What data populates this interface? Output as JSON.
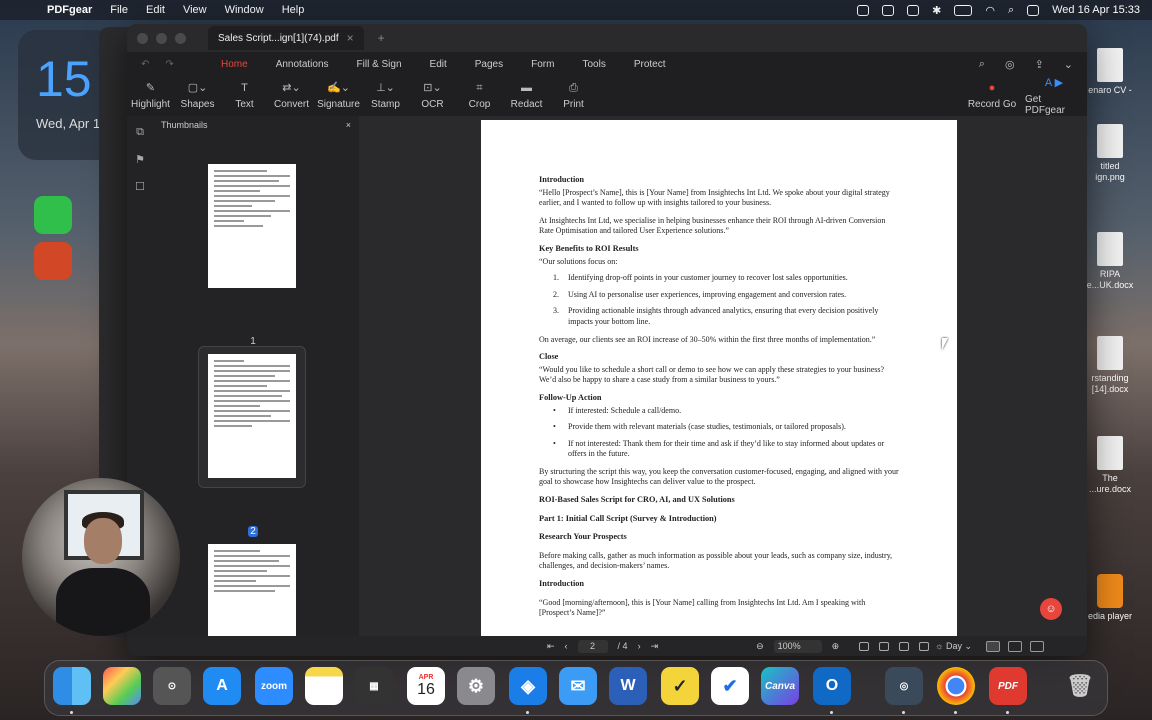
{
  "menubar": {
    "app": "PDFgear",
    "items": [
      "File",
      "Edit",
      "View",
      "Window",
      "Help"
    ],
    "clock": "Wed 16 Apr  15:33"
  },
  "desktop": {
    "widget": {
      "day": "15",
      "date": "Wed, Apr 1"
    },
    "files": [
      "enaro CV -",
      "titled\nign.png",
      "RIPA\ne...UK.docx",
      "rstanding\n[14].docx",
      "The\n...ure.docx",
      "edia player"
    ]
  },
  "window": {
    "tab_title": "Sales Script...ign[1](74).pdf",
    "menus": [
      "Home",
      "Annotations",
      "Fill & Sign",
      "Edit",
      "Pages",
      "Form",
      "Tools",
      "Protect"
    ],
    "active_menu": "Home",
    "tools": [
      "Highlight",
      "Shapes",
      "Text",
      "Convert",
      "Signature",
      "Stamp",
      "OCR",
      "Crop",
      "Redact",
      "Print"
    ],
    "right_tools": [
      "Record Go",
      "Get PDFgear"
    ],
    "sidebar": {
      "title": "Thumbnails",
      "pages": [
        "1",
        "2"
      ]
    },
    "page_nav": {
      "current": "2",
      "total": "/ 4"
    },
    "zoom": "100%",
    "theme": "Day"
  },
  "document": {
    "h_intro": "Introduction",
    "p1": "“Hello [Prospect’s Name], this is [Your Name] from Insightechs Int Ltd. We spoke about your digital strategy earlier, and I wanted to follow up with insights tailored to your business.",
    "p2": "At Insightechs Int Ltd, we specialise in helping businesses enhance their ROI through AI-driven Conversion Rate Optimisation and tailored User Experience solutions.”",
    "h_key": "Key Benefits to ROI Results",
    "p3": "“Our solutions focus on:",
    "li1": "Identifying drop-off points in your customer journey to recover lost sales opportunities.",
    "li2": "Using AI to personalise user experiences, improving engagement and conversion rates.",
    "li3": "Providing actionable insights through advanced analytics, ensuring that every decision positively impacts your bottom line.",
    "p4": "On average, our clients see an ROI increase of 30–50% within the first three months of implementation.”",
    "h_close": "Close",
    "p5": "“Would you like to schedule a short call or demo to see how we can apply these strategies to your business? We’d also be happy to share a case study from a similar business to yours.”",
    "h_follow": "Follow-Up Action",
    "b1": "If interested: Schedule a call/demo.",
    "b2": "Provide them with relevant materials (case studies, testimonials, or tailored proposals).",
    "b3": "If not interested: Thank them for their time and ask if they’d like to stay informed about updates or offers in the future.",
    "p6": "By structuring the script this way, you keep the conversation customer-focused, engaging, and aligned with your goal to showcase how Insightechs can deliver value to the prospect.",
    "h_roi": "ROI-Based Sales Script for CRO, AI, and UX Solutions",
    "h_part1": "Part 1: Initial Call Script (Survey & Introduction)",
    "h_research": "Research Your Prospects",
    "p7": "Before making calls, gather as much information as possible about your leads, such as company size, industry, challenges, and decision-makers’ names.",
    "h_intro2": "Introduction",
    "p8": "“Good [morning/afternoon], this is [Your Name] calling from Insightechs Int Ltd. Am I speaking with [Prospect’s Name]?”"
  },
  "dock": {
    "zoom": "zoom",
    "calendar_month": "APR",
    "calendar_day": "16",
    "canva": "Canva"
  }
}
